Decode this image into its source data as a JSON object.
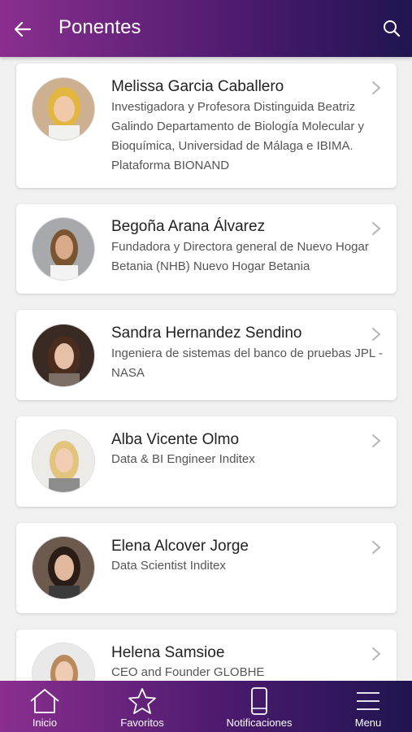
{
  "header": {
    "title": "Ponentes",
    "back_icon": "arrow-left-icon",
    "search_icon": "search-icon"
  },
  "speakers": [
    {
      "name": "Melissa Garcia Caballero",
      "role": "Investigadora y Profesora Distinguida Beatriz Galindo Departamento de Biología Molecular y Bioquímica, Universidad de Málaga e IBIMA. Plataforma BIONAND"
    },
    {
      "name": "Begoña Arana Álvarez",
      "role": "Fundadora y Directora general de Nuevo Hogar Betania (NHB) Nuevo Hogar Betania"
    },
    {
      "name": "Sandra Hernandez Sendino",
      "role": "Ingeniera de sistemas del banco de pruebas JPL - NASA"
    },
    {
      "name": "Alba Vicente Olmo",
      "role": "Data & BI Engineer  Inditex"
    },
    {
      "name": "Elena Alcover Jorge",
      "role": "Data Scientist Inditex"
    },
    {
      "name": "Helena Samsioe",
      "role": "CEO and Founder GLOBHE"
    }
  ],
  "bottom_nav": [
    {
      "label": "Inicio",
      "icon": "home-icon"
    },
    {
      "label": "Favoritos",
      "icon": "star-icon"
    },
    {
      "label": "Notificaciones",
      "icon": "phone-icon"
    },
    {
      "label": "Menu",
      "icon": "hamburger-menu-icon"
    }
  ],
  "colors": {
    "gradient_start": "#8a2f8f",
    "gradient_end": "#1f1550",
    "background": "#f0f0f0"
  }
}
